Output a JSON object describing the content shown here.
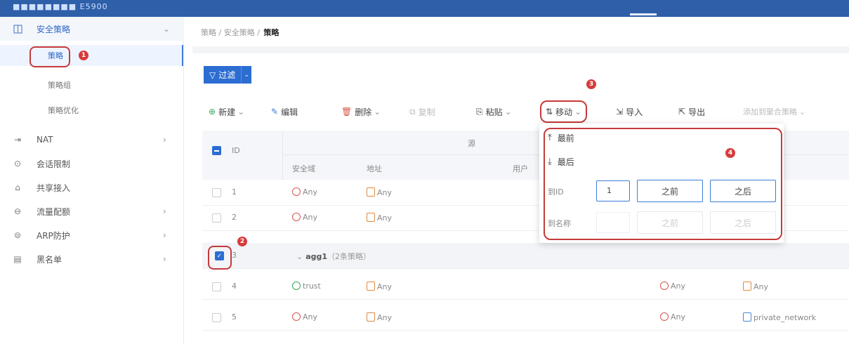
{
  "app": {
    "brand": "■■■■■■■■ E5900"
  },
  "sidebar": {
    "group": {
      "label": "安全策略",
      "icon": "policy-icon"
    },
    "subitems": [
      {
        "label": "策略",
        "active": true
      },
      {
        "label": "策略组"
      },
      {
        "label": "策略优化"
      }
    ],
    "items": [
      {
        "label": "NAT",
        "icon": "nat-icon",
        "has_children": true
      },
      {
        "label": "会话限制",
        "icon": "session-icon",
        "has_children": false
      },
      {
        "label": "共享接入",
        "icon": "share-icon",
        "has_children": false
      },
      {
        "label": "流量配额",
        "icon": "traffic-icon",
        "has_children": true
      },
      {
        "label": "ARP防护",
        "icon": "arp-icon",
        "has_children": true
      },
      {
        "label": "黑名单",
        "icon": "blacklist-icon",
        "has_children": true
      }
    ]
  },
  "breadcrumb": {
    "path": "策略 / 安全策略 / ",
    "current": "策略"
  },
  "filter": {
    "label": "过滤"
  },
  "toolbar": {
    "new": "新建",
    "edit": "编辑",
    "delete": "删除",
    "copy": "复制",
    "paste": "粘贴",
    "move": "移动",
    "import": "导入",
    "export": "导出",
    "add_to_aggregate": "添加到聚合策略"
  },
  "table": {
    "header_group": "源",
    "columns": {
      "id": "ID",
      "zone": "安全域",
      "address": "地址",
      "user": "用户"
    },
    "rows": [
      {
        "id": "1",
        "zone": "Any",
        "address": "Any",
        "dst_zone": "",
        "dst_addr": ""
      },
      {
        "id": "2",
        "zone": "Any",
        "address": "Any",
        "dst_zone": "",
        "dst_addr": ""
      },
      {
        "id": "3",
        "group_name": "agg1",
        "group_note": "（2条策略）"
      },
      {
        "id": "4",
        "zone": "trust",
        "address": "Any",
        "dst_zone": "Any",
        "dst_addr": "Any"
      },
      {
        "id": "5",
        "zone": "Any",
        "address": "Any",
        "dst_zone": "Any",
        "dst_addr": "private_network"
      }
    ]
  },
  "move_menu": {
    "top": "最前",
    "bottom": "最后",
    "to_id_label": "到ID",
    "to_id_value": "1",
    "to_name_label": "到名称",
    "before": "之前",
    "after": "之后"
  },
  "annotations": [
    "1",
    "2",
    "3",
    "4"
  ],
  "colors": {
    "accent": "#2c6dd2",
    "annotation": "#c63a3a",
    "topbar": "#2f5fa8"
  }
}
